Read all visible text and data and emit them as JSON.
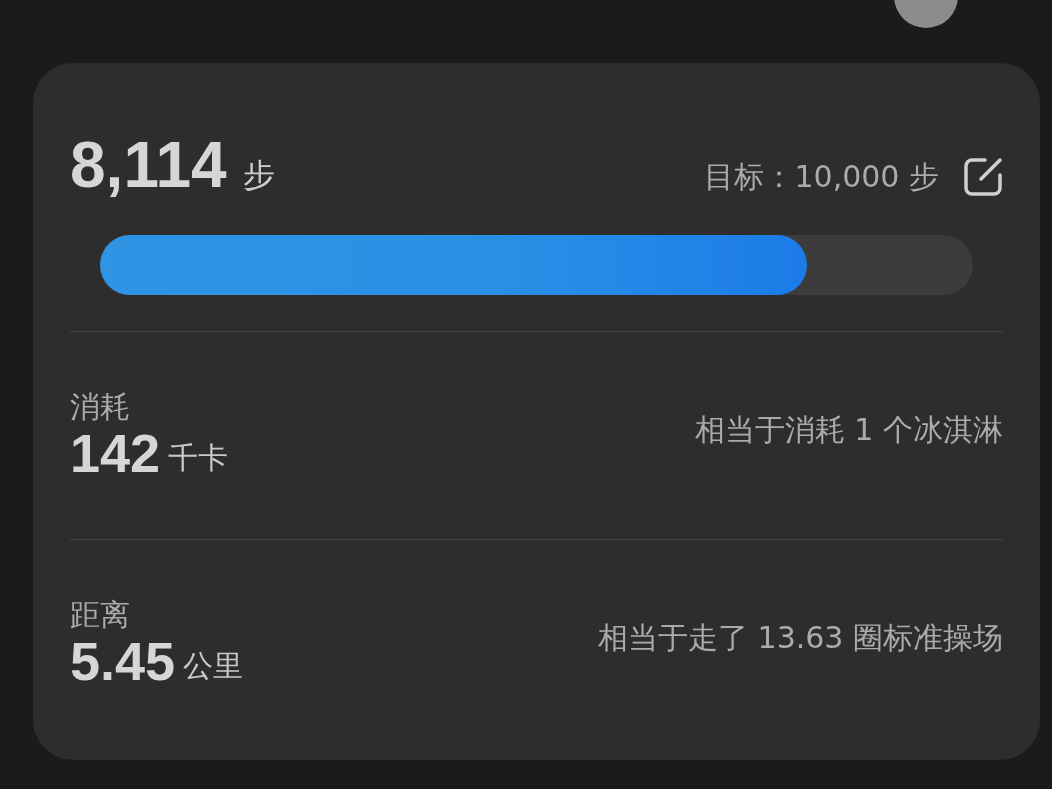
{
  "steps": {
    "value": "8,114",
    "unit": "步",
    "goal_label": "目标：",
    "goal_value": "10,000",
    "goal_unit": "步",
    "level": 0.81
  },
  "stats": [
    {
      "label": "消耗",
      "value": "142",
      "unit": "千卡",
      "note": "相当于消耗 1 个冰淇淋"
    },
    {
      "label": "距离",
      "value": "5.45",
      "unit": "公里",
      "note": "相当于走了 13.63 圈标准操场"
    }
  ]
}
